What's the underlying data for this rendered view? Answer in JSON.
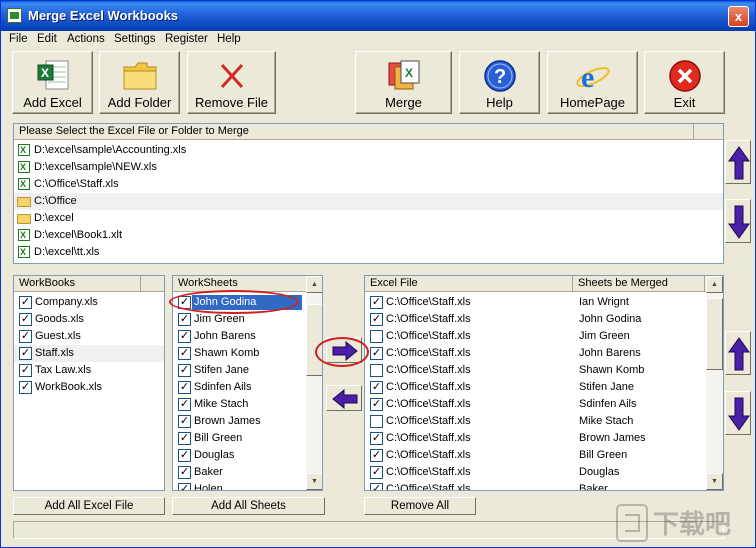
{
  "window": {
    "title": "Merge Excel Workbooks",
    "close_label": "x"
  },
  "menu": {
    "items": [
      "File",
      "Edit",
      "Actions",
      "Settings",
      "Register",
      "Help"
    ]
  },
  "toolbar": {
    "add_excel": "Add Excel",
    "add_folder": "Add Folder",
    "remove_file": "Remove File",
    "merge": "Merge",
    "help": "Help",
    "homepage": "HomePage",
    "exit": "Exit"
  },
  "file_list": {
    "header": "Please Select the Excel File or Folder to Merge",
    "items": [
      {
        "type": "xls",
        "path": "D:\\excel\\sample\\Accounting.xls"
      },
      {
        "type": "xls",
        "path": "D:\\excel\\sample\\NEW.xls"
      },
      {
        "type": "xls",
        "path": "C:\\Office\\Staff.xls"
      },
      {
        "type": "folder",
        "path": "C:\\Office"
      },
      {
        "type": "folder",
        "path": "D:\\excel"
      },
      {
        "type": "xls",
        "path": "D:\\excel\\Book1.xlt"
      },
      {
        "type": "xls",
        "path": "D:\\excel\\tt.xls"
      }
    ],
    "selected_index": 3
  },
  "workbooks": {
    "header": "WorkBooks",
    "items": [
      "Company.xls",
      "Goods.xls",
      "Guest.xls",
      "Staff.xls",
      "Tax Law.xls",
      "WorkBook.xls"
    ],
    "selected_index": 3
  },
  "worksheets": {
    "header": "WorkSheets",
    "items": [
      "John Godina",
      "Jim Green",
      "John Barens",
      "Shawn Komb",
      "Stifen Jane",
      "Sdinfen Ails",
      "Mike Stach",
      "Brown James",
      "Bill Green",
      "Douglas",
      "Baker",
      "Holen"
    ],
    "selected_index": 0
  },
  "merged": {
    "col_file": "Excel File",
    "col_sheet": "Sheets be Merged",
    "rows": [
      {
        "checked": true,
        "file": "C:\\Office\\Staff.xls",
        "sheet": "Ian Wrignt"
      },
      {
        "checked": true,
        "file": "C:\\Office\\Staff.xls",
        "sheet": "John Godina"
      },
      {
        "checked": false,
        "file": "C:\\Office\\Staff.xls",
        "sheet": "Jim Green"
      },
      {
        "checked": true,
        "file": "C:\\Office\\Staff.xls",
        "sheet": "John Barens"
      },
      {
        "checked": false,
        "file": "C:\\Office\\Staff.xls",
        "sheet": "Shawn Komb"
      },
      {
        "checked": true,
        "file": "C:\\Office\\Staff.xls",
        "sheet": "Stifen Jane"
      },
      {
        "checked": true,
        "file": "C:\\Office\\Staff.xls",
        "sheet": "Sdinfen Ails"
      },
      {
        "checked": false,
        "file": "C:\\Office\\Staff.xls",
        "sheet": "Mike Stach"
      },
      {
        "checked": true,
        "file": "C:\\Office\\Staff.xls",
        "sheet": "Brown James"
      },
      {
        "checked": true,
        "file": "C:\\Office\\Staff.xls",
        "sheet": "Bill Green"
      },
      {
        "checked": true,
        "file": "C:\\Office\\Staff.xls",
        "sheet": "Douglas"
      },
      {
        "checked": true,
        "file": "C:\\Office\\Staff.xls",
        "sheet": "Baker"
      }
    ]
  },
  "bottom": {
    "add_all_excel": "Add All Excel File",
    "add_all_sheets": "Add All Sheets",
    "remove_all": "Remove All"
  },
  "watermark": "下载吧",
  "colors": {
    "accent_blue": "#3b5bdb",
    "arrow_purple": "#4b1fa6",
    "highlight": "#316ac5",
    "annotation_red": "#d21e1e"
  }
}
